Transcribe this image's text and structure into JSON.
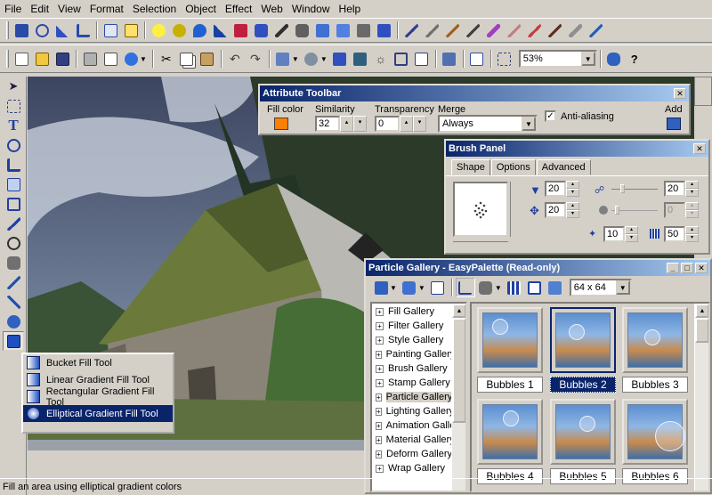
{
  "menu": [
    "File",
    "Edit",
    "View",
    "Format",
    "Selection",
    "Object",
    "Effect",
    "Web",
    "Window",
    "Help"
  ],
  "zoom": "53%",
  "attribute_toolbar": {
    "title": "Attribute Toolbar",
    "fill_color_label": "Fill color",
    "fill_color": "#ff8000",
    "similarity_label": "Similarity",
    "similarity_value": "32",
    "transparency_label": "Transparency",
    "transparency_value": "0",
    "merge_label": "Merge",
    "merge_value": "Always",
    "antialias_label": "Anti-aliasing",
    "antialias_checked": true,
    "add_label": "Add"
  },
  "brush_panel": {
    "title": "Brush Panel",
    "tabs": [
      "Shape",
      "Options",
      "Advanced"
    ],
    "size": "20",
    "rotation": "20",
    "softness": "20",
    "opacity_disabled": "0",
    "density": "10",
    "spacing": "50"
  },
  "gallery": {
    "title": "Particle Gallery - EasyPalette (Read-only)",
    "thumb_size": "64 x 64",
    "tree": [
      "Fill Gallery",
      "Filter Gallery",
      "Style Gallery",
      "Painting Gallery",
      "Brush Gallery",
      "Stamp Gallery",
      "Particle Gallery",
      "Lighting Gallery",
      "Animation Gallery",
      "Material Gallery",
      "Deform Gallery",
      "Wrap Gallery"
    ],
    "selected_tree_index": 6,
    "items": [
      "Bubbles 1",
      "Bubbles 2",
      "Bubbles 3",
      "Bubbles 4",
      "Bubbles 5",
      "Bubbles 6"
    ],
    "selected_item_index": 1
  },
  "flyout": {
    "items": [
      "Bucket Fill Tool",
      "Linear Gradient Fill Tool",
      "Rectangular Gradient Fill Tool",
      "Elliptical Gradient Fill Tool"
    ],
    "selected_index": 3
  },
  "status_text": "Fill an area using elliptical gradient colors",
  "colors": {
    "title_start": "#0a246a",
    "title_end": "#a6caf0",
    "selection": "#0a246a",
    "chrome": "#d4d0c8"
  }
}
